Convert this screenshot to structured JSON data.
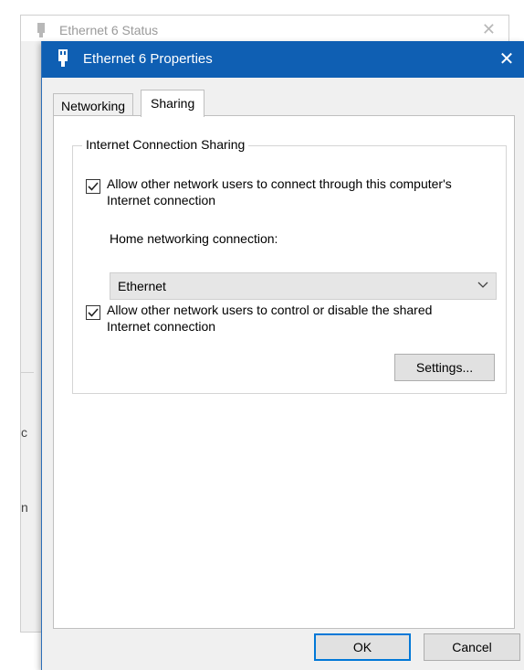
{
  "background_window": {
    "title": "Ethernet 6 Status",
    "fragments": [
      "c",
      "n"
    ]
  },
  "dialog": {
    "title": "Ethernet 6 Properties",
    "close_glyph": "✕",
    "tabs": [
      {
        "label": "Networking",
        "selected": false
      },
      {
        "label": "Sharing",
        "selected": true
      }
    ],
    "group_title": "Internet Connection Sharing",
    "allow_connect": {
      "checked": true,
      "label": "Allow other network users to connect through this computer's Internet connection"
    },
    "home_connection_label": "Home networking connection:",
    "home_connection_value": "Ethernet",
    "allow_control": {
      "checked": true,
      "label": "Allow other network users to control or disable the shared Internet connection"
    },
    "settings_label": "Settings...",
    "ok_label": "OK",
    "cancel_label": "Cancel"
  },
  "colors": {
    "titlebar": "#0f5fb3",
    "accent": "#0078d7"
  },
  "icons": {
    "title_icon": "network-adapter-icon",
    "dropdown": "chevron-down-icon",
    "checkbox": "checkmark-icon"
  }
}
